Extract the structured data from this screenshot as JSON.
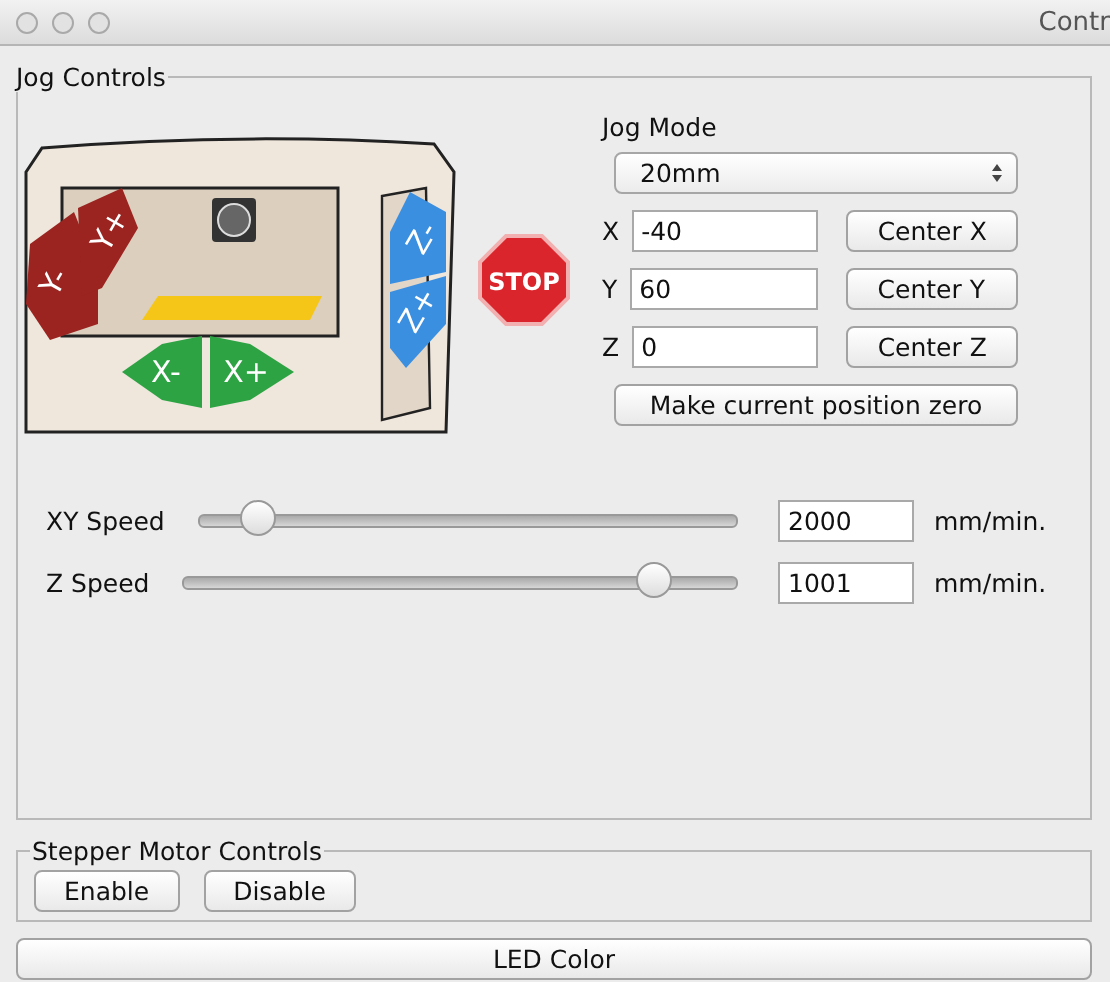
{
  "window": {
    "title": "Contr"
  },
  "jog_controls": {
    "title": "Jog Controls",
    "jog_buttons": [
      {
        "kind": "y",
        "label": "Y-"
      },
      {
        "kind": "y",
        "label": "Y+"
      },
      {
        "kind": "z",
        "label": "Z-"
      },
      {
        "kind": "z",
        "label": "Z+"
      },
      {
        "kind": "x",
        "label": "X-"
      },
      {
        "kind": "x",
        "label": "X+"
      },
      {
        "kind": "stop",
        "label": "STOP"
      }
    ],
    "jog_mode": {
      "label": "Jog Mode",
      "value": "20mm"
    },
    "axes": [
      {
        "label": "X",
        "value": "-40",
        "button": "Center X"
      },
      {
        "label": "Y",
        "value": "60",
        "button": "Center Y"
      },
      {
        "label": "Z",
        "value": "0",
        "button": "Center Z"
      }
    ],
    "zero_button": "Make current position zero",
    "speeds": [
      {
        "label": "XY Speed",
        "level": 0.11,
        "value": "2000",
        "unit": "mm/min."
      },
      {
        "label": "Z Speed",
        "level": 0.85,
        "value": "1001",
        "unit": "mm/min."
      }
    ]
  },
  "stepper_motor_controls": {
    "title": "Stepper Motor Controls",
    "buttons": [
      "Enable",
      "Disable"
    ]
  },
  "led_button": "LED Color"
}
